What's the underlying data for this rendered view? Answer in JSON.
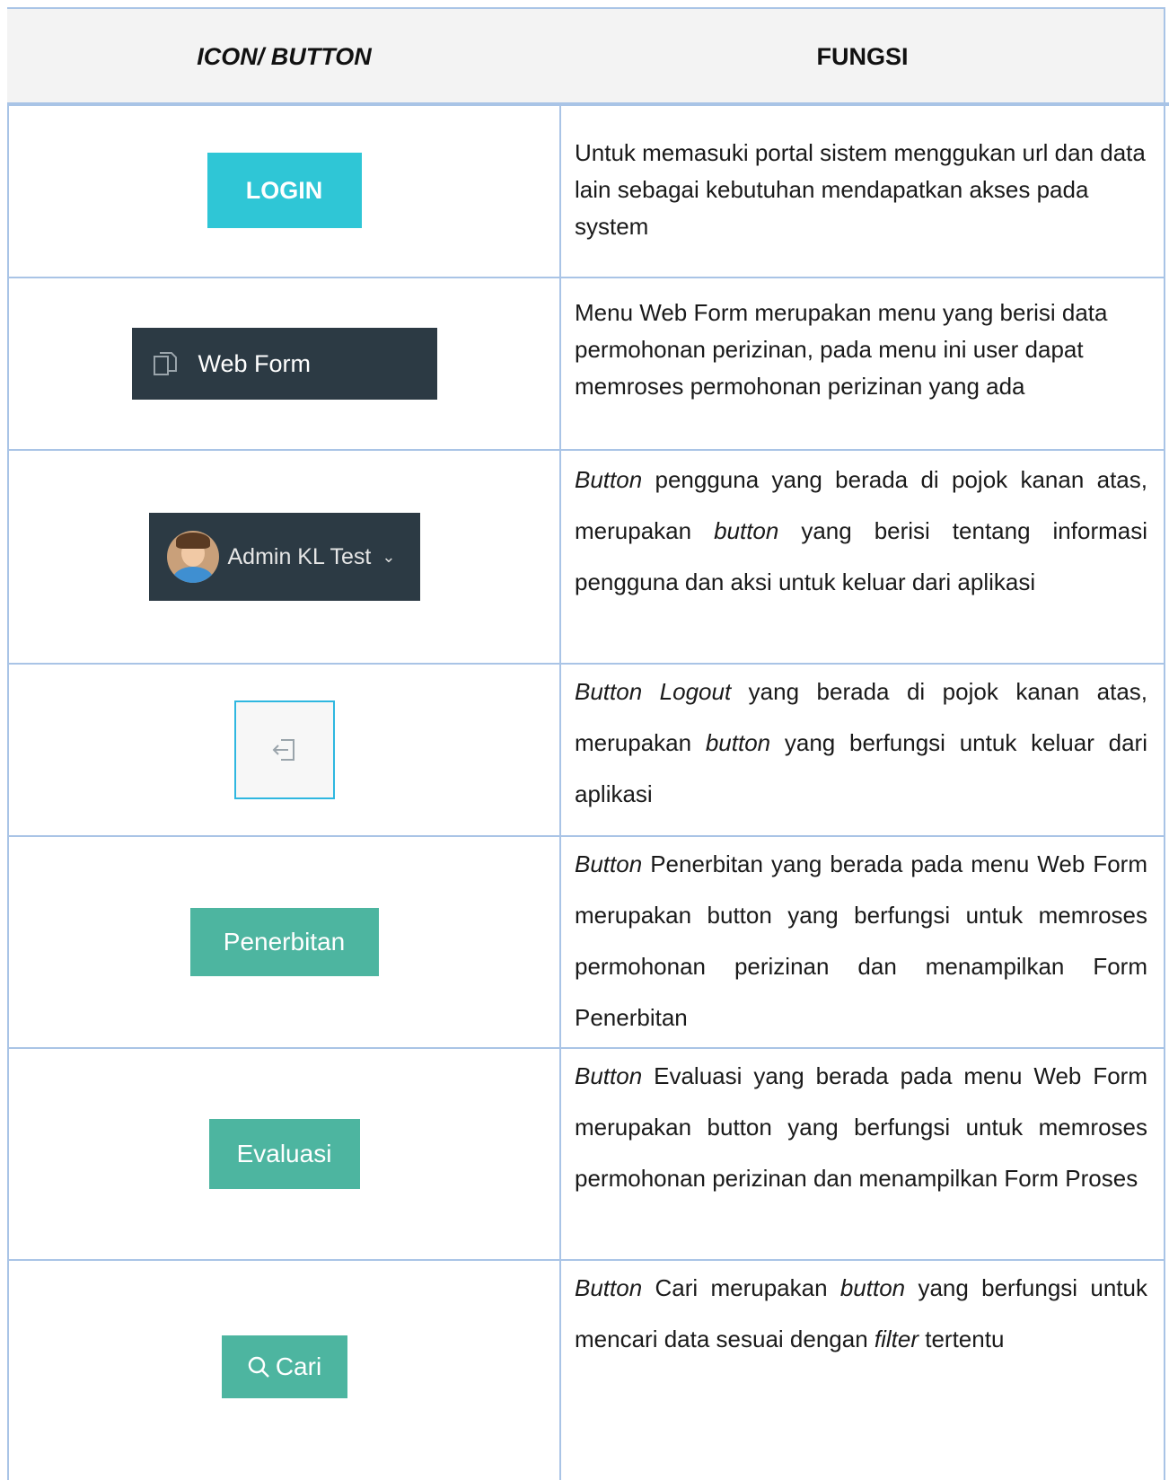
{
  "table": {
    "header": {
      "col1": "ICON/ BUTTON",
      "col2": "FUNGSI"
    },
    "rows": [
      {
        "button_label": "LOGIN",
        "icon": "none",
        "description_parts": [
          {
            "text": "Untuk memasuki portal sistem menggukan url dan data lain sebagai kebutuhan mendapatkan akses pada system",
            "italic": false
          }
        ]
      },
      {
        "button_label": "Web Form",
        "icon": "copy-icon",
        "description_parts": [
          {
            "text": "Menu Web Form  merupakan menu yang berisi data permohonan perizinan, pada menu ini user dapat memroses permohonan perizinan yang ada",
            "italic": false
          }
        ]
      },
      {
        "button_label": "Admin KL Test",
        "icon": "avatar",
        "description_parts": [
          {
            "text": "Button",
            "italic": true
          },
          {
            "text": " pengguna yang berada di pojok kanan atas, merupakan ",
            "italic": false
          },
          {
            "text": "button",
            "italic": true
          },
          {
            "text": " yang berisi tentang informasi pengguna dan aksi untuk keluar dari aplikasi",
            "italic": false
          }
        ]
      },
      {
        "button_label": "",
        "icon": "logout-icon",
        "description_parts": [
          {
            "text": "Button Logout",
            "italic": true
          },
          {
            "text": " yang berada di pojok kanan atas, merupakan ",
            "italic": false
          },
          {
            "text": "button",
            "italic": true
          },
          {
            "text": " yang berfungsi untuk keluar dari aplikasi",
            "italic": false
          }
        ]
      },
      {
        "button_label": "Penerbitan",
        "icon": "none",
        "description_parts": [
          {
            "text": "Button",
            "italic": true
          },
          {
            "text": "  Penerbitan yang berada pada menu Web Form merupakan button yang berfungsi untuk memroses permohonan perizinan dan menampilkan Form Penerbitan",
            "italic": false
          }
        ]
      },
      {
        "button_label": "Evaluasi",
        "icon": "none",
        "description_parts": [
          {
            "text": "Button",
            "italic": true
          },
          {
            "text": "  Evaluasi yang berada pada menu Web Form merupakan button yang berfungsi untuk memroses permohonan perizinan dan menampilkan Form Proses",
            "italic": false
          }
        ]
      },
      {
        "button_label": "Cari",
        "icon": "search-icon",
        "description_parts": [
          {
            "text": "Button",
            "italic": true
          },
          {
            "text": " Cari merupakan ",
            "italic": false
          },
          {
            "text": "button",
            "italic": true
          },
          {
            "text": " yang berfungsi untuk mencari data sesuai dengan ",
            "italic": false
          },
          {
            "text": "filter",
            "italic": true
          },
          {
            "text": " tertentu",
            "italic": false
          }
        ]
      }
    ]
  },
  "colors": {
    "border": "#a9c4e6",
    "login": "#2fc6d6",
    "dark": "#2c3a44",
    "green": "#4db5a0"
  }
}
